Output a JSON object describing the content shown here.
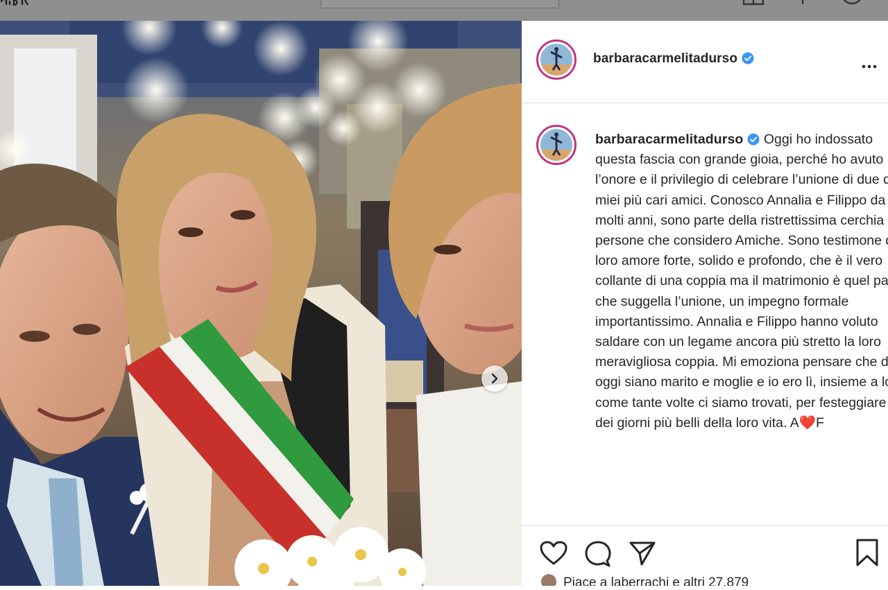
{
  "post": {
    "username": "barbaracarmelitadurso",
    "verified": true,
    "caption": "Oggi ho indossato questa fascia con grande gioia, perché ho avuto l’onore e il privilegio di celebrare l’unione di due dei miei più cari amici. Conosco Annalia e Filippo da molti anni, sono parte della ristrettissima cerchia di persone che considero Amiche. Sono testimone del loro amore forte, solido e profondo, che è il vero collante di una coppia ma il matrimonio è quel passo che suggella l’unione, un impegno formale importantissimo. Annalia e Filippo hanno voluto saldare con un legame ancora più stretto la loro meravigliosa coppia. Mi emoziona pensare che da oggi siano marito e moglie e io ero lì, insieme a loro, come tante volte ci siamo trovati, per festeggiare uno dei giorni più belli della loro vita. A❤️F",
    "likes_text": "Piace a laberrachi e altri 27.879"
  },
  "icons": {
    "more": "more-options-icon",
    "like": "heart-icon",
    "comment": "comment-icon",
    "share": "share-icon",
    "save": "bookmark-icon",
    "next": "chevron-right-icon",
    "verified": "verified-badge-icon"
  },
  "colors": {
    "verified": "#3897f0",
    "avatar_ring": "#c13584",
    "text": "#262626",
    "divider": "#dbdbdb",
    "topbar": "#8f8f8f"
  }
}
